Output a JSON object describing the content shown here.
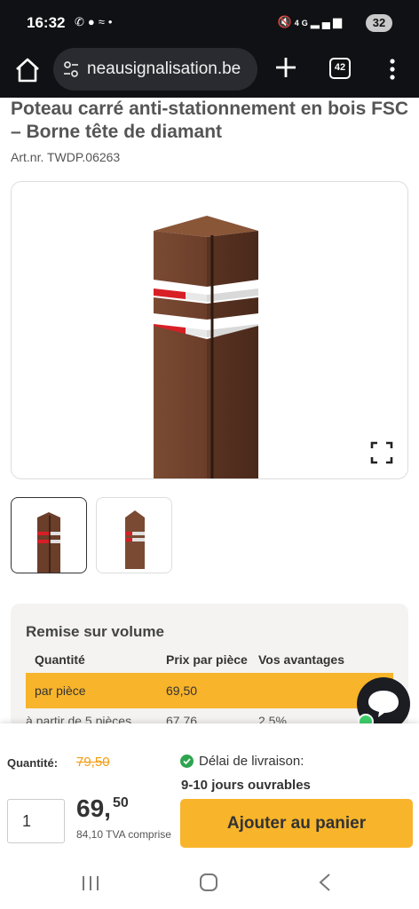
{
  "status_bar": {
    "time": "16:32",
    "left_icons": [
      "missed-call-icon",
      "chat-icon",
      "voicemail-icon",
      "dot-icon"
    ],
    "right_icons": [
      "mute-icon",
      "4g-icon",
      "signal-icon"
    ],
    "battery": "32"
  },
  "browser": {
    "url": "neausignalisation.be",
    "tab_count": "42"
  },
  "product": {
    "title": "Poteau carré anti-stationnement en bois FSC – Borne tête de diamant",
    "art_nr": "Art.nr. TWDP.06263"
  },
  "volume": {
    "title": "Remise sur volume",
    "headers": [
      "Quantité",
      "Prix par pièce",
      "Vos avantages"
    ],
    "rows": [
      [
        "par pièce",
        "69,50",
        ""
      ],
      [
        "à partir de 5 pièces",
        "67,76",
        "2,5%"
      ]
    ]
  },
  "purchase": {
    "qty_label": "Quantité:",
    "old_price": "79,50",
    "delivery_label": "Délai de livraison:",
    "delivery_value": "9-10 jours ouvrables",
    "qty_value": "1",
    "price_int": "69,",
    "price_dec": "50",
    "price_vat": "84,10 TVA comprise",
    "add_to_cart": "Ajouter au panier"
  },
  "colors": {
    "accent": "#f8b42a",
    "old_price": "#f39c12",
    "wood": "#6e3f2a",
    "reflector_red": "#d81f26",
    "online_green": "#3ecf69"
  }
}
